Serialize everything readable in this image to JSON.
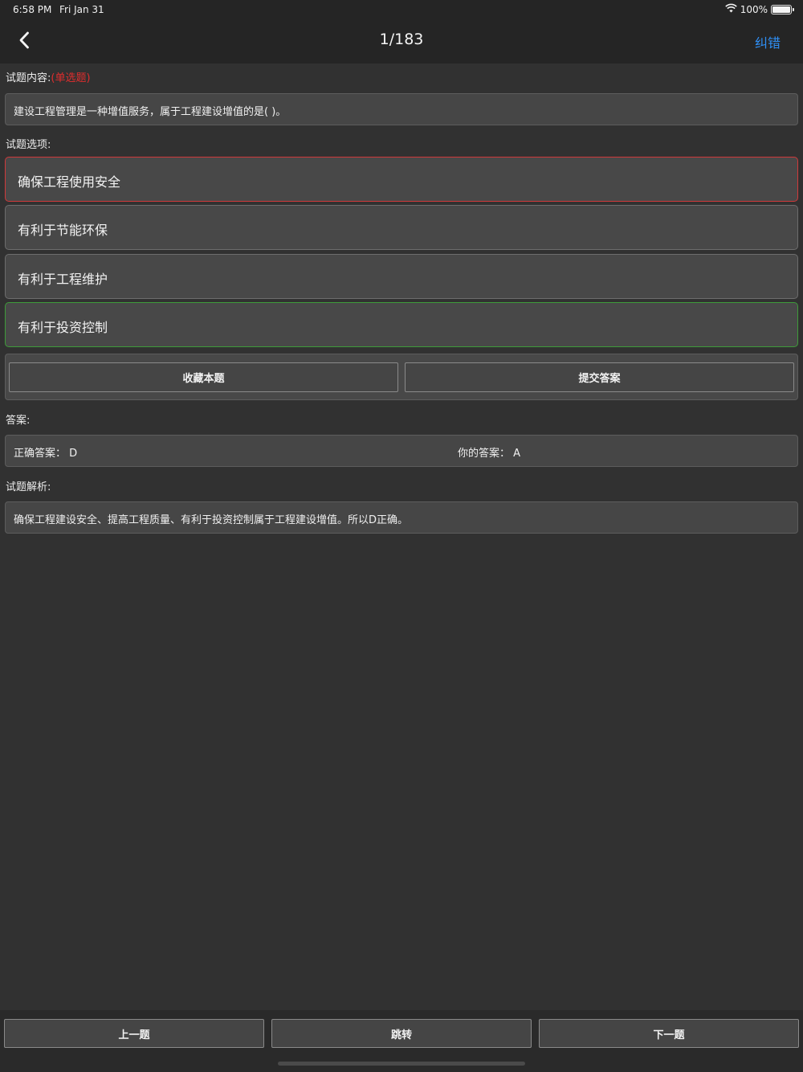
{
  "status_bar": {
    "time": "6:58 PM",
    "date": "Fri Jan 31",
    "battery": "100%",
    "wifi_icon": "wifi-icon",
    "battery_icon": "battery-icon"
  },
  "nav": {
    "title": "1/183",
    "action_label": "纠错",
    "back_icon": "chevron-left-icon",
    "accent_color": "#2f8ff5"
  },
  "question": {
    "label": "试题内容:",
    "type_tag": "(单选题)",
    "text": "建设工程管理是一种增值服务，属于工程建设增值的是( )。"
  },
  "options": {
    "label": "试题选项:",
    "items": [
      {
        "text": "确保工程使用安全",
        "state": "wrong"
      },
      {
        "text": "有利于节能环保",
        "state": "normal"
      },
      {
        "text": "有利于工程维护",
        "state": "normal"
      },
      {
        "text": "有利于投资控制",
        "state": "correct"
      }
    ]
  },
  "actions": {
    "favorite_label": "收藏本题",
    "submit_label": "提交答案"
  },
  "answer": {
    "label": "答案:",
    "correct_label": "正确答案：",
    "correct_value": "D",
    "yours_label": "你的答案：",
    "yours_value": "A"
  },
  "analysis": {
    "label": "试题解析:",
    "text": "确保工程建设安全、提高工程质量、有利于投资控制属于工程建设增值。所以D正确。"
  },
  "bottom": {
    "prev_label": "上一题",
    "jump_label": "跳转",
    "next_label": "下一题"
  },
  "colors": {
    "wrong_border": "#d0393b",
    "correct_border": "#3e9b3a",
    "type_tag": "#e02d2d"
  }
}
